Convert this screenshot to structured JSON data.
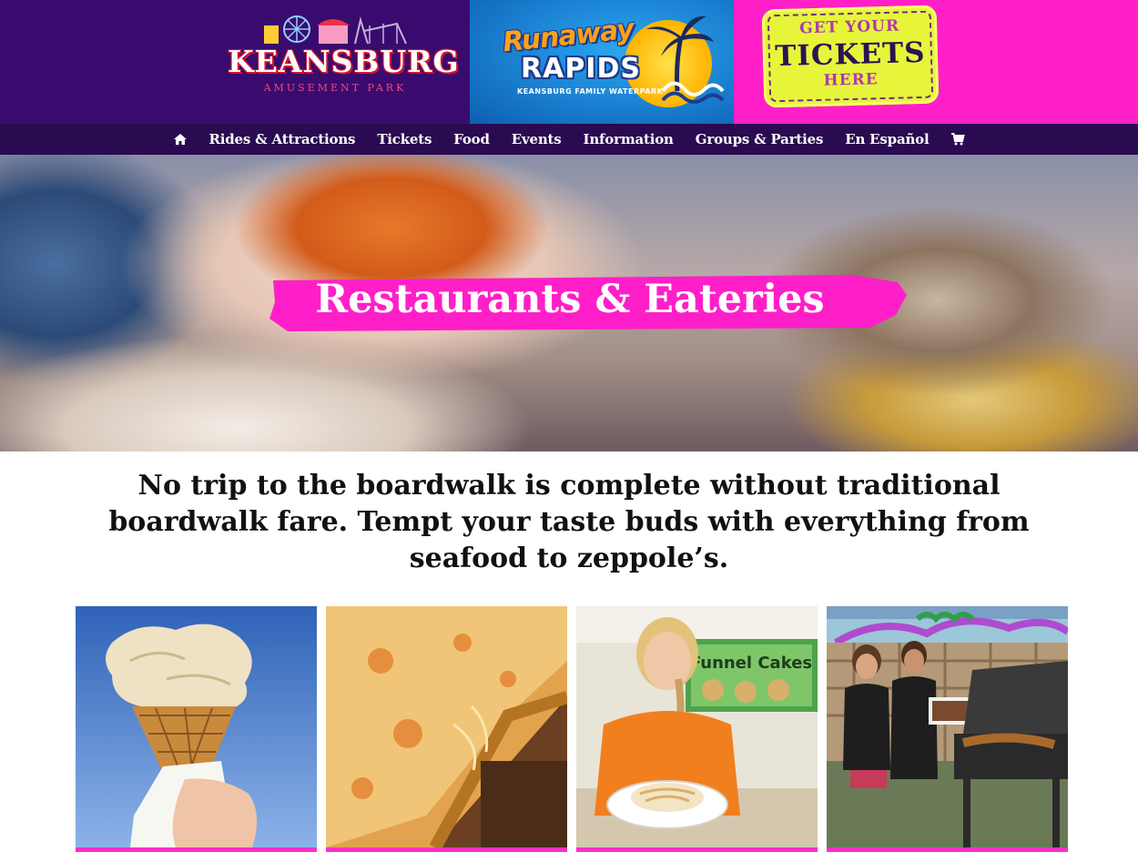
{
  "banner": {
    "keansburg_name": "KEANSBURG",
    "keansburg_sub": "AMUSEMENT PARK",
    "rapids_runaway": "Runaway",
    "rapids_rapids": "RAPIDS",
    "rapids_sub": "KEANSBURG FAMILY WATERPARK",
    "tickets_line1": "GET YOUR",
    "tickets_line2": "TICKETS",
    "tickets_line3": "HERE"
  },
  "nav": {
    "items": [
      {
        "label": "Rides & Attractions"
      },
      {
        "label": "Tickets"
      },
      {
        "label": "Food"
      },
      {
        "label": "Events"
      },
      {
        "label": "Information"
      },
      {
        "label": "Groups & Parties"
      },
      {
        "label": "En Español"
      }
    ],
    "home_icon": "home-icon",
    "cart_icon": "shopping-cart-icon"
  },
  "hero": {
    "title": "Restaurants & Eateries"
  },
  "intro": {
    "text": "No trip to the boardwalk is complete without traditional boardwalk fare. Tempt your taste buds with everything from seafood to zeppole’s."
  },
  "photos": {
    "items": [
      {
        "subject": "ice-cream-cone"
      },
      {
        "subject": "pizza-slice"
      },
      {
        "subject": "funnel-cake-server"
      },
      {
        "subject": "grill-staff"
      }
    ],
    "funnel_sign": "Funnel Cakes"
  },
  "colors": {
    "purple_dark": "#2a0a50",
    "purple": "#3a0b6e",
    "blue": "#1a7fd0",
    "magenta": "#ff1fc8",
    "accent_pink": "#ff2fc5"
  }
}
